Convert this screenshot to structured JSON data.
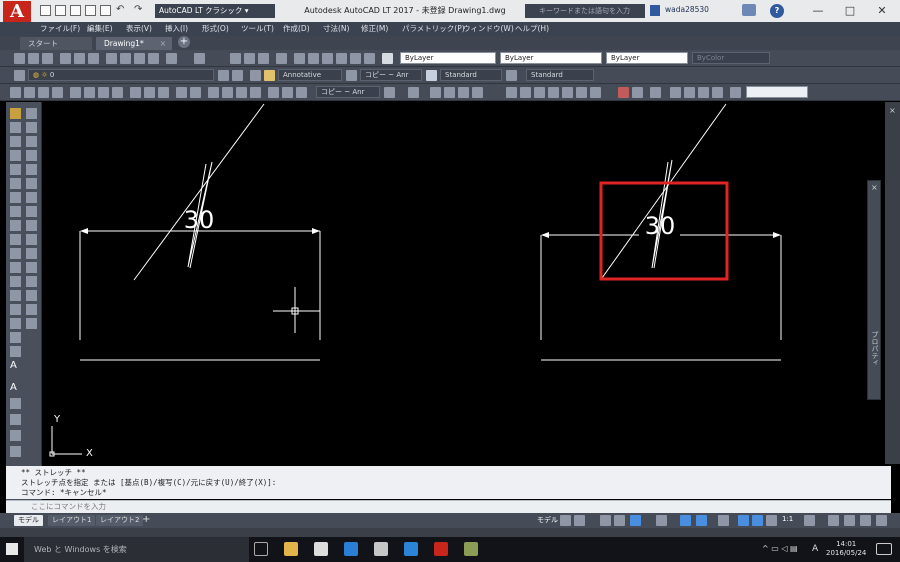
{
  "app": {
    "logo": "A",
    "logo_sub": "LT"
  },
  "titlebar": {
    "workspace": "AutoCAD LT クラシック",
    "title": "Autodesk AutoCAD LT 2017 - 未登録    Drawing1.dwg",
    "search_placeholder": "キーワードまたは語句を入力",
    "user": "wada28530",
    "help": "?",
    "win_min": "—",
    "win_max": "□",
    "win_close": "✕"
  },
  "menu": [
    "ファイル(F)",
    "編集(E)",
    "表示(V)",
    "挿入(I)",
    "形式(O)",
    "ツール(T)",
    "作成(D)",
    "寸法(N)",
    "修正(M)",
    "パラメトリック(P)",
    "ウィンドウ(W)",
    "ヘルプ(H)"
  ],
  "tabs": {
    "start": "スタート",
    "drawing": "Drawing1*",
    "close": "×",
    "plus": "+"
  },
  "toolbar": {
    "layer_current": "0",
    "color": "ByLayer",
    "linetype": "ByLayer",
    "lineweight": "ByLayer",
    "plotstyle": "ByColor",
    "annoscale": "Annotative",
    "textstyle1": "コピー ~ Anr",
    "dimstyle": "Standard",
    "tablestyle": "Standard",
    "dimstyle2": "コピー ~ Anr"
  },
  "canvas": {
    "dim_left": "30",
    "dim_right": "30",
    "ucs_x": "X",
    "ucs_y": "Y",
    "highlight_color": "#e02424"
  },
  "command": {
    "history": [
      "** ストレッチ **",
      "ストレッチ点を指定 または [基点(B)/複写(C)/元に戻す(U)/終了(X)]:",
      "コマンド: *キャンセル*"
    ],
    "input_placeholder": "ここにコマンドを入力"
  },
  "status": {
    "layout_tabs": [
      "モデル",
      "レイアウト1",
      "レイアウト2"
    ],
    "plus": "+",
    "model_label": "モデル",
    "scale": "1:1"
  },
  "props_palette": {
    "title": "プロパティ"
  },
  "taskbar": {
    "search": "Web と Windows を検索",
    "time": "14:01",
    "date": "2016/05/24",
    "ime": "A"
  }
}
